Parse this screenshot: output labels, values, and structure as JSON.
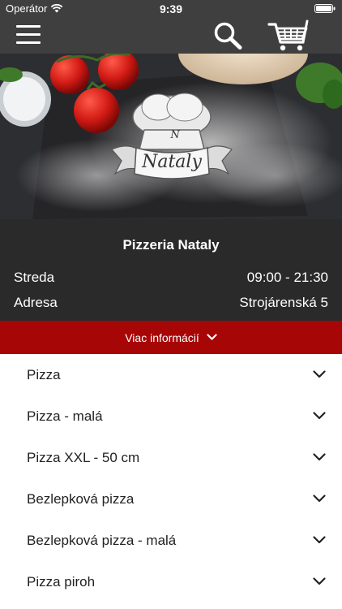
{
  "status_bar": {
    "carrier": "Operátor",
    "time": "9:39"
  },
  "hero": {
    "logo_text": "Nataly",
    "logo_initial": "N"
  },
  "restaurant": {
    "name": "Pizzeria Nataly",
    "day_label": "Streda",
    "hours": "09:00 - 21:30",
    "address_label": "Adresa",
    "address": "Strojárenská 5"
  },
  "more_info": {
    "label": "Viac informácií"
  },
  "categories": [
    {
      "label": "Pizza"
    },
    {
      "label": "Pizza - malá"
    },
    {
      "label": "Pizza XXL - 50 cm"
    },
    {
      "label": "Bezlepková pizza"
    },
    {
      "label": "Bezlepková pizza - malá"
    },
    {
      "label": "Pizza piroh"
    }
  ],
  "colors": {
    "bar": "#3f3f3f",
    "panel": "#2a2a2a",
    "accent": "#a70606"
  },
  "icons": [
    "wifi-icon",
    "battery-icon",
    "menu-icon",
    "search-icon",
    "cart-icon",
    "chevron-down-icon"
  ]
}
